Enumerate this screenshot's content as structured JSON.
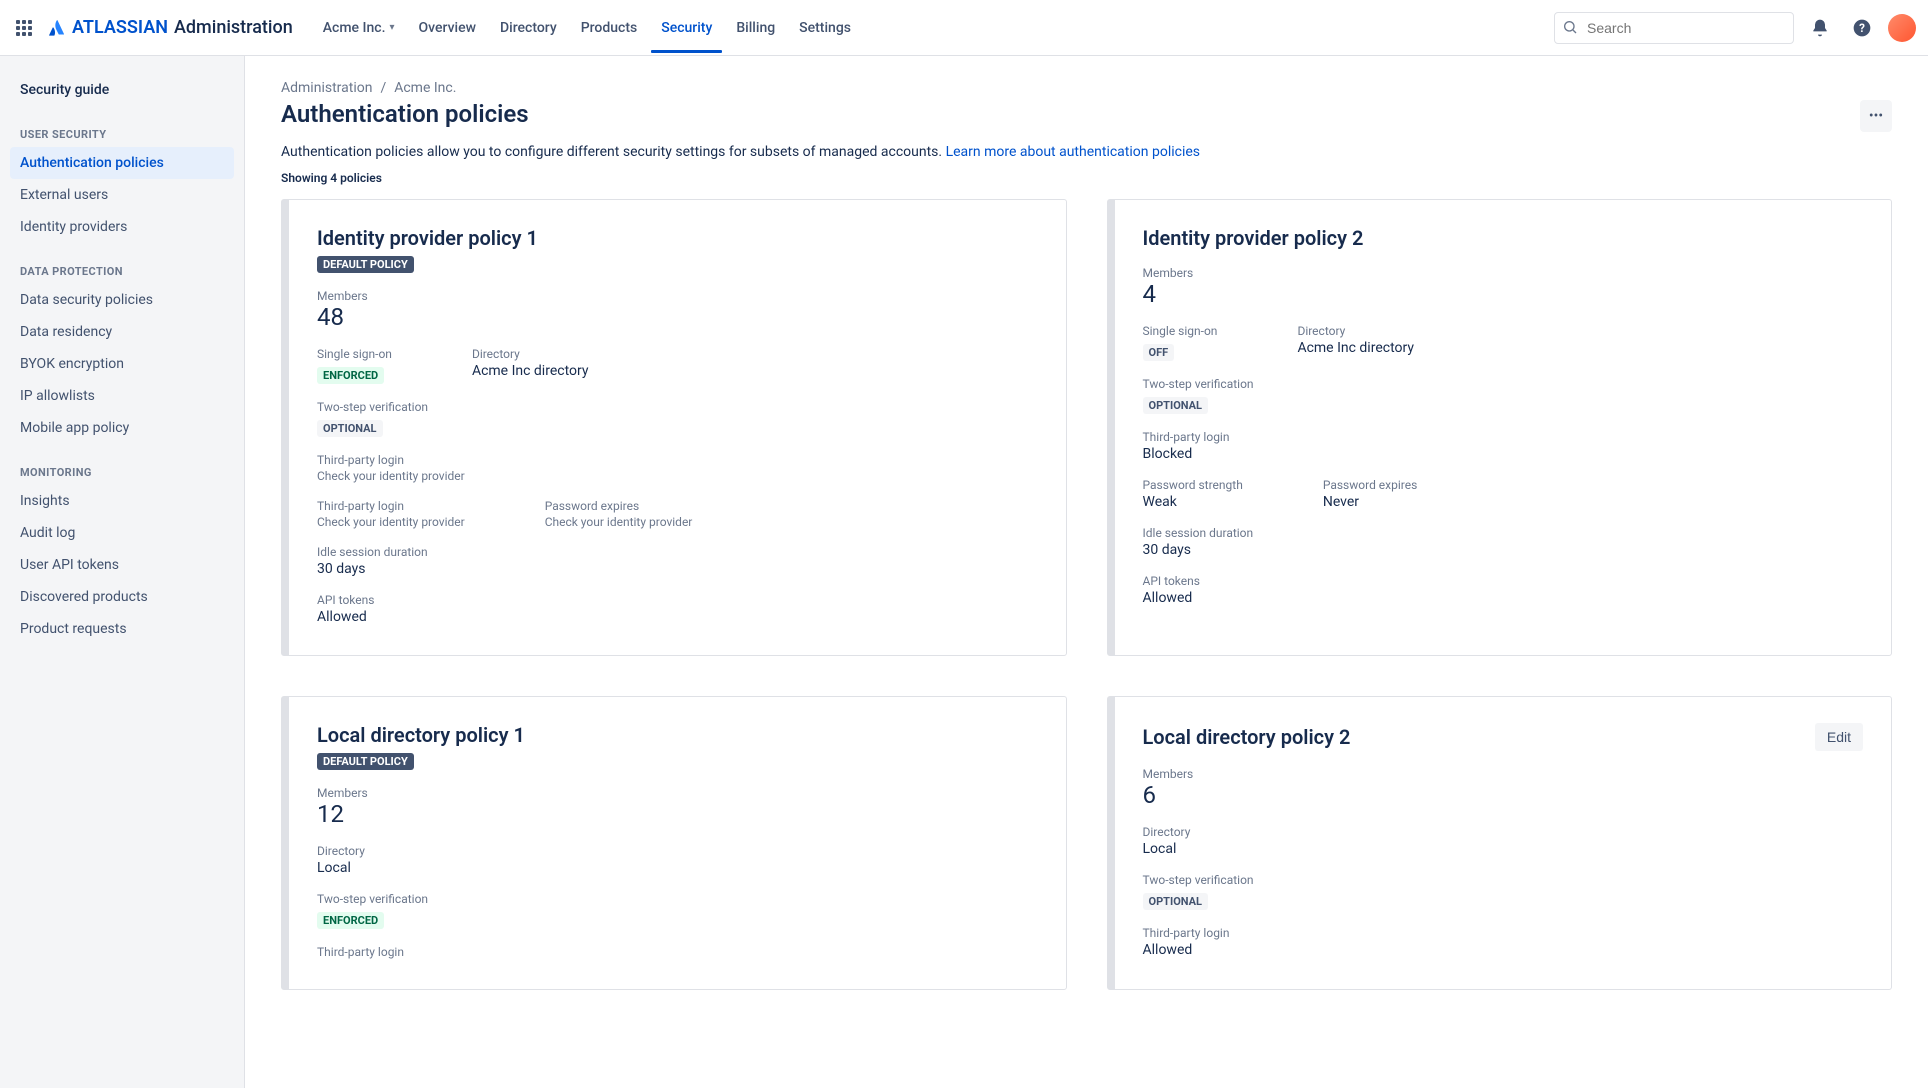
{
  "header": {
    "brand_name": "ATLASSIAN",
    "brand_suffix": "Administration",
    "org_switch": "Acme Inc.",
    "nav": [
      "Overview",
      "Directory",
      "Products",
      "Security",
      "Billing",
      "Settings"
    ],
    "search_placeholder": "Search"
  },
  "sidebar": {
    "top": "Security guide",
    "groups": [
      {
        "label": "USER SECURITY",
        "items": [
          "Authentication policies",
          "External users",
          "Identity providers"
        ]
      },
      {
        "label": "DATA PROTECTION",
        "items": [
          "Data security policies",
          "Data residency",
          "BYOK encryption",
          "IP allowlists",
          "Mobile app policy"
        ]
      },
      {
        "label": "MONITORING",
        "items": [
          "Insights",
          "Audit log",
          "User API tokens",
          "Discovered products",
          "Product requests"
        ]
      }
    ]
  },
  "breadcrumb": {
    "a": "Administration",
    "b": "Acme Inc."
  },
  "page": {
    "title": "Authentication policies",
    "desc_a": "Authentication policies allow you to configure different security settings for subsets of managed accounts. ",
    "desc_link": "Learn more about authentication policies",
    "showing": "Showing 4 policies"
  },
  "labels": {
    "members": "Members",
    "sso": "Single sign-on",
    "directory": "Directory",
    "twostep": "Two-step verification",
    "thirdparty": "Third-party login",
    "pwexpires": "Password expires",
    "idle": "Idle session duration",
    "apitokens": "API tokens",
    "pwstrength": "Password strength",
    "enforced": "ENFORCED",
    "optional": "OPTIONAL",
    "off": "OFF",
    "default": "DEFAULT POLICY",
    "checkidp": "Check your identity provider",
    "edit": "Edit"
  },
  "cards": [
    {
      "title": "Identity provider policy 1",
      "default": true,
      "members": "48",
      "sso": "ENFORCED",
      "directory": "Acme Inc directory",
      "twostep": "OPTIONAL",
      "thirdparty1_sub": "Check your identity provider",
      "thirdparty2_sub": "Check your identity provider",
      "pwexpires_sub": "Check your identity provider",
      "idle": "30 days",
      "apitokens": "Allowed"
    },
    {
      "title": "Identity provider policy 2",
      "members": "4",
      "sso": "OFF",
      "directory": "Acme Inc directory",
      "twostep": "OPTIONAL",
      "thirdparty": "Blocked",
      "pwstrength": "Weak",
      "pwexpires": "Never",
      "idle": "30 days",
      "apitokens": "Allowed"
    },
    {
      "title": "Local directory policy 1",
      "default": true,
      "members": "12",
      "directory": "Local",
      "twostep": "ENFORCED",
      "thirdparty_label_only": true
    },
    {
      "title": "Local directory policy 2",
      "edit": true,
      "members": "6",
      "directory": "Local",
      "twostep": "OPTIONAL",
      "thirdparty": "Allowed"
    }
  ]
}
